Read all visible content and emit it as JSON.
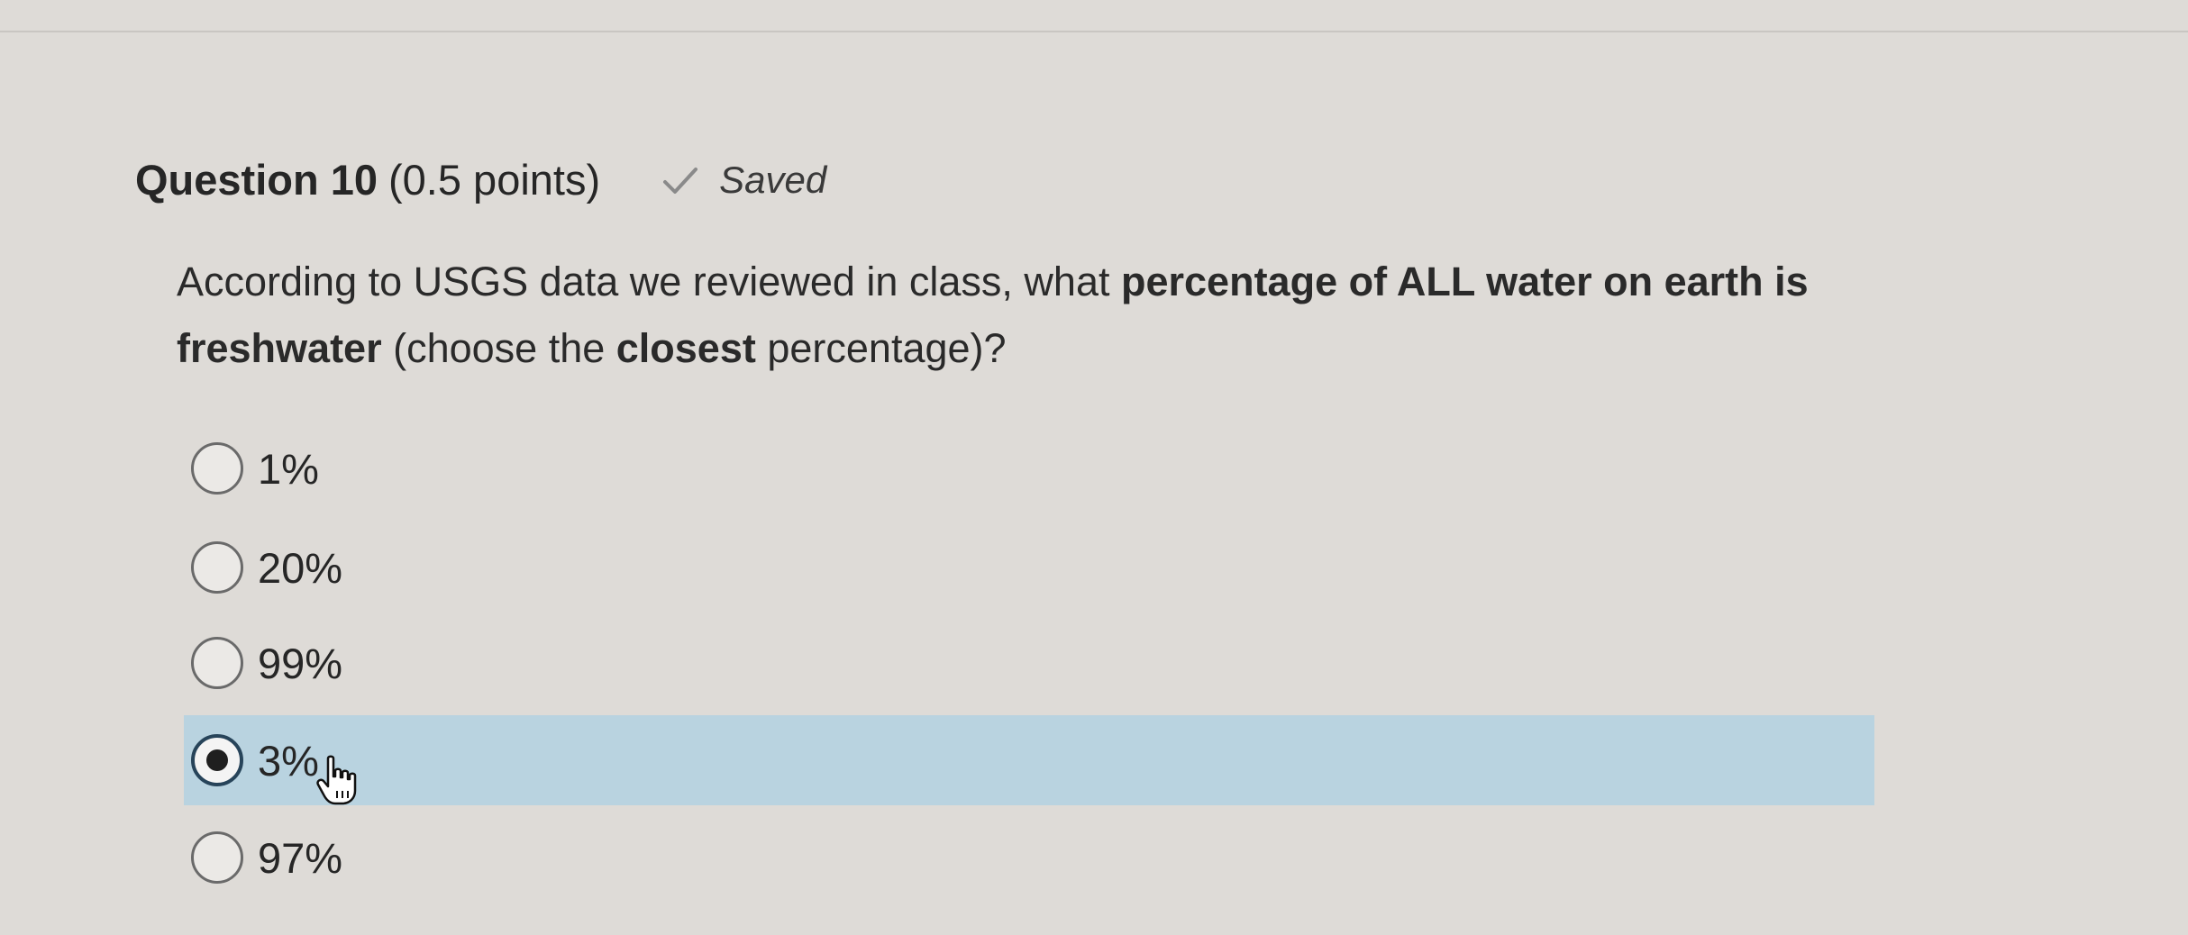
{
  "question": {
    "title": "Question 10",
    "points": "(0.5 points)",
    "saved_label": "Saved",
    "text_parts": [
      {
        "text": "According to USGS data we reviewed in class, what ",
        "bold": false
      },
      {
        "text": "percentage of ALL water",
        "bold": true
      },
      {
        "text": " on earth is freshwater",
        "bold": true
      },
      {
        "text": " (choose the ",
        "bold": false
      },
      {
        "text": "closest",
        "bold": true
      },
      {
        "text": " percentage)?",
        "bold": false
      }
    ],
    "options": [
      {
        "label": "1%",
        "selected": false
      },
      {
        "label": "20%",
        "selected": false
      },
      {
        "label": "99%",
        "selected": false
      },
      {
        "label": "3%",
        "selected": true
      },
      {
        "label": "97%",
        "selected": false
      }
    ]
  },
  "icons": {
    "saved": "check-icon",
    "cursor": "hand-pointer-icon"
  },
  "colors": {
    "page_background": "#dedbd7",
    "selected_highlight": "#b9d3e0",
    "radio_checked_border": "#27445a"
  }
}
